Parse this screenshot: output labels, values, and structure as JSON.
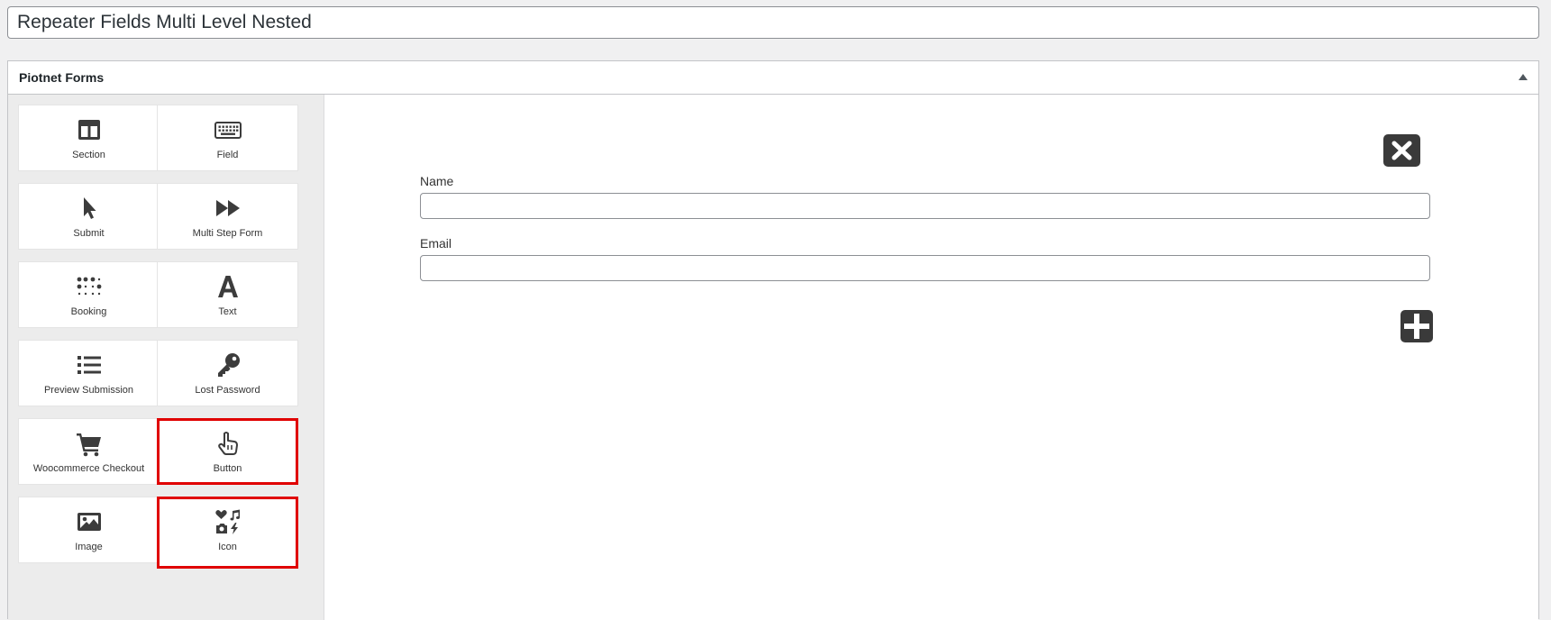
{
  "post_title": "Repeater Fields Multi Level Nested",
  "panel": {
    "title": "Piotnet Forms"
  },
  "widgets": [
    {
      "label": "Section",
      "icon": "section-columns-icon"
    },
    {
      "label": "Field",
      "icon": "keyboard-icon"
    },
    {
      "label": "Submit",
      "icon": "mouse-pointer-icon"
    },
    {
      "label": "Multi Step Form",
      "icon": "fast-forward-icon"
    },
    {
      "label": "Booking",
      "icon": "braille-icon"
    },
    {
      "label": "Text",
      "icon": "letter-a-icon"
    },
    {
      "label": "Preview Submission",
      "icon": "list-icon"
    },
    {
      "label": "Lost Password",
      "icon": "key-icon"
    },
    {
      "label": "Woocommerce Checkout",
      "icon": "cart-icon"
    },
    {
      "label": "Button",
      "icon": "hand-pointer-icon"
    },
    {
      "label": "Image",
      "icon": "image-icon"
    },
    {
      "label": "Icon",
      "icon": "icons-icon"
    }
  ],
  "highlight_color": "#e00000",
  "form": {
    "fields": [
      {
        "label": "Name",
        "value": ""
      },
      {
        "label": "Email",
        "value": ""
      }
    ],
    "remove_button_icon": "close-icon",
    "add_button_icon": "plus-icon"
  }
}
